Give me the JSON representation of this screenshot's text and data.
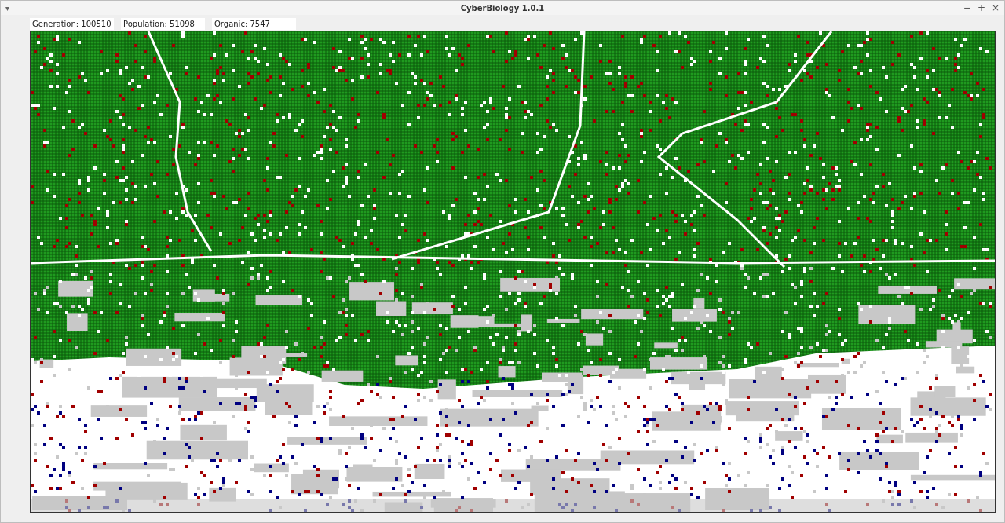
{
  "window": {
    "title": "CyberBiology 1.0.1",
    "menu_glyph": "▾",
    "controls": [
      "−",
      "+",
      "×"
    ]
  },
  "stats": [
    {
      "label": "Generation: 100510"
    },
    {
      "label": "Population: 51098"
    },
    {
      "label": "Organic: 7547"
    }
  ]
}
